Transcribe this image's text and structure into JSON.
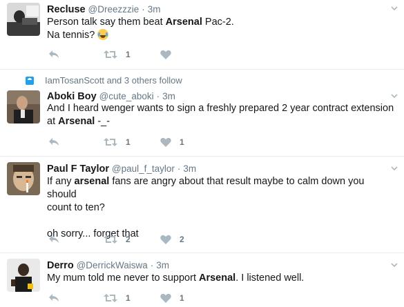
{
  "tweets": [
    {
      "name": "Recluse",
      "handle": "@Dreezzzie",
      "sep": "·",
      "time": "3m",
      "text_parts": [
        "Person talk say them beat ",
        "Arsenal",
        " Pac-2."
      ],
      "line2": "Na tennis? ",
      "emoji": "face-with-tears-of-joy",
      "retweets": "1",
      "likes": ""
    },
    {
      "social_context": "IamTosanScott and 3 others follow",
      "name": "Aboki Boy",
      "handle": "@cute_aboki",
      "sep": "·",
      "time": "3m",
      "line1": "And I heard wenger wants to sign a freshly prepared 2 year contract extension",
      "line2_parts": [
        "at ",
        "Arsenal",
        " -_-"
      ],
      "retweets": "1",
      "likes": "1"
    },
    {
      "name": "Paul F Taylor",
      "handle": "@paul_f_taylor",
      "sep": "·",
      "time": "3m",
      "line1_parts": [
        "If any ",
        "arsenal",
        " fans are angry about that result maybe to calm down you should"
      ],
      "line2": "count to ten?",
      "line3": "oh sorry... forget that",
      "retweets": "2",
      "likes": "2"
    },
    {
      "name": "Derro",
      "handle": "@DerrickWaiswa",
      "sep": "·",
      "time": "3m",
      "text_parts": [
        "My mum told me never to support ",
        "Arsenal",
        ". I listened well."
      ],
      "retweets": "1",
      "likes": "1"
    }
  ],
  "colors": {
    "text": "#14171a",
    "muted": "#657786",
    "icon": "#aab8c2",
    "divider": "#e6ecf0",
    "link": "#1da1f2"
  }
}
